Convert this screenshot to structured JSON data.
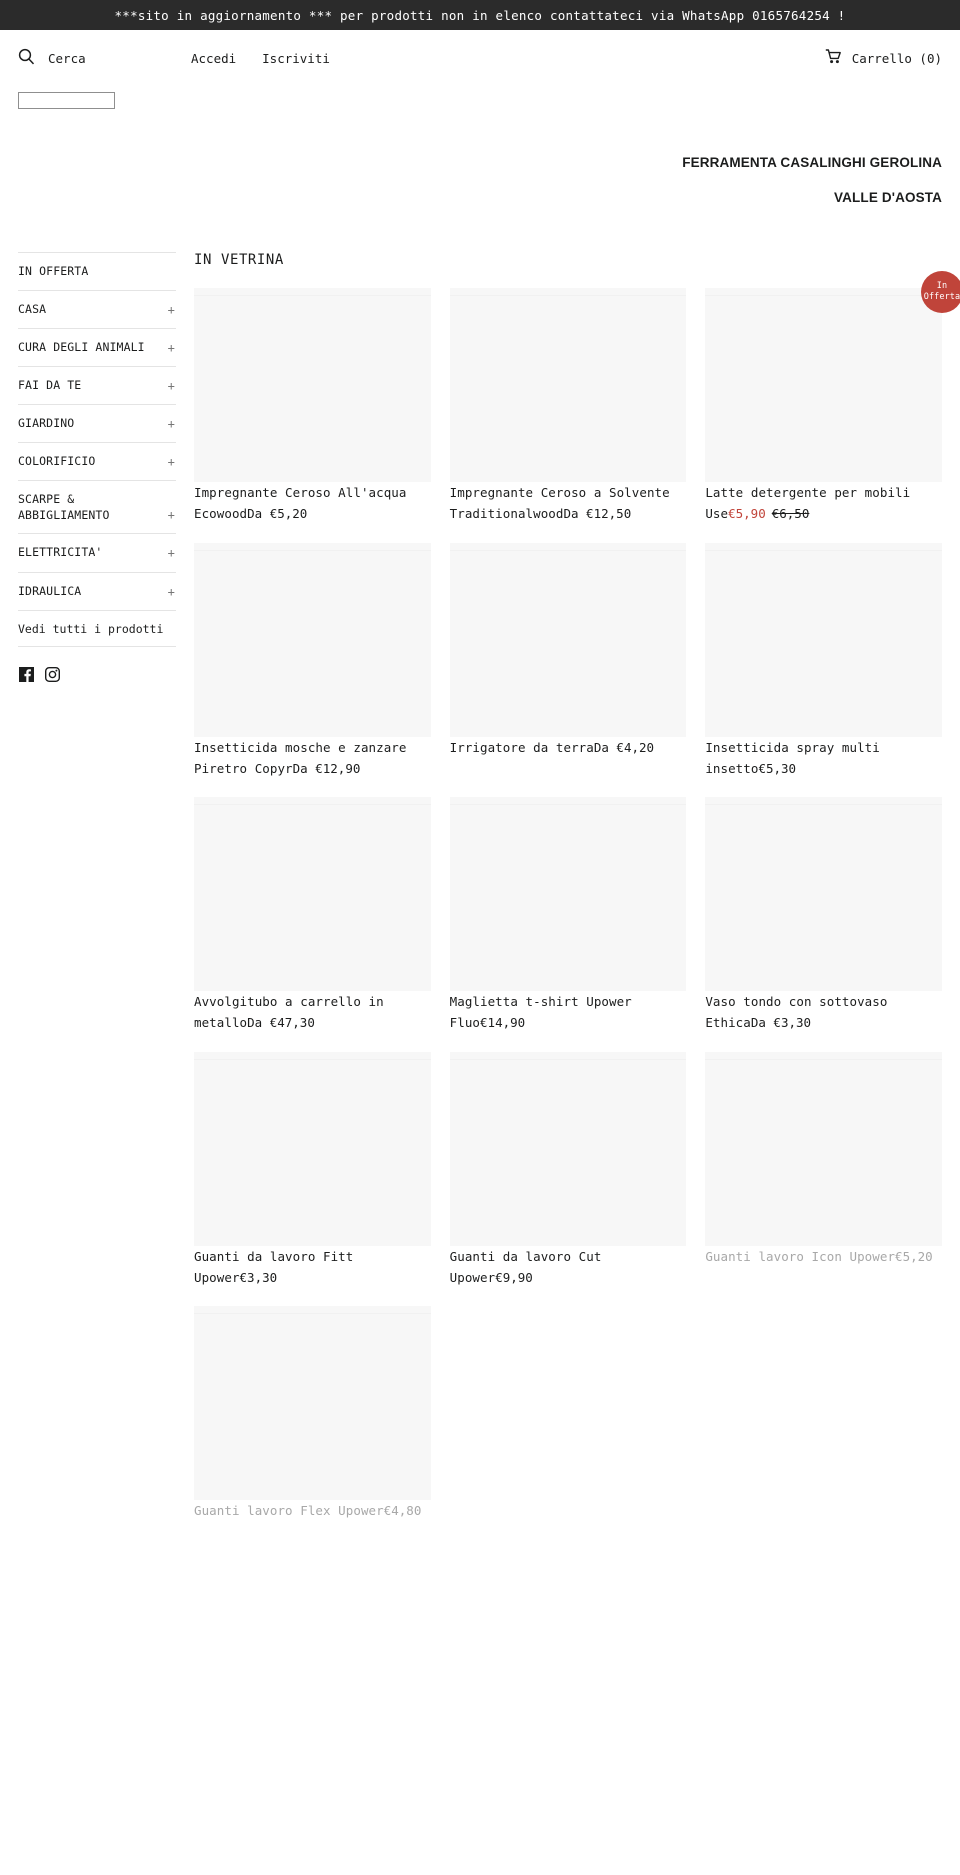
{
  "announcement": {
    "text": "***sito in aggiornamento *** per prodotti non in elenco contattateci via WhatsApp 0165764254 !"
  },
  "header": {
    "search_label": "Cerca",
    "search_placeholder": "",
    "search_value": "",
    "login_label": "Accedi",
    "register_label": "Iscriviti",
    "cart_label": "Carrello (0)"
  },
  "store": {
    "name_line1": "FERRAMENTA CASALINGHI GEROLINA",
    "name_line2": "VALLE D'AOSTA"
  },
  "sidebar": {
    "items": [
      {
        "label": "IN OFFERTA",
        "expander": ""
      },
      {
        "label": "CASA",
        "expander": "+"
      },
      {
        "label": "CURA DEGLI ANIMALI",
        "expander": "+"
      },
      {
        "label": "FAI DA TE",
        "expander": "+"
      },
      {
        "label": "GIARDINO",
        "expander": "+"
      },
      {
        "label": "COLORIFICIO",
        "expander": "+"
      },
      {
        "label": "SCARPE & ABBIGLIAMENTO",
        "expander": "+"
      },
      {
        "label": "ELETTRICITA'",
        "expander": "+"
      },
      {
        "label": "IDRAULICA",
        "expander": "+"
      }
    ],
    "view_all_label": "Vedi tutti i prodotti",
    "social": [
      {
        "name": "facebook-icon"
      },
      {
        "name": "instagram-icon"
      }
    ]
  },
  "main": {
    "section_title": "IN VETRINA",
    "products": [
      {
        "title": "Impregnante Ceroso All'acqua Ecowood",
        "price": "Da €5,20",
        "sale_price": "",
        "compare_price": "",
        "badge": "",
        "sold_out": false
      },
      {
        "title": "Impregnante Ceroso a Solvente Traditionalwood",
        "price": "Da €12,50",
        "sale_price": "",
        "compare_price": "",
        "badge": "",
        "sold_out": false
      },
      {
        "title": "Latte detergente per mobili Use",
        "price": "",
        "sale_price": "€5,90",
        "compare_price": "€6,50",
        "badge": "In Offerta",
        "sold_out": false
      },
      {
        "title": "Insetticida mosche e zanzare Piretro Copyr",
        "price": "Da €12,90",
        "sale_price": "",
        "compare_price": "",
        "badge": "",
        "sold_out": false
      },
      {
        "title": "Irrigatore da terra",
        "price": "Da €4,20",
        "sale_price": "",
        "compare_price": "",
        "badge": "",
        "sold_out": false
      },
      {
        "title": "Insetticida spray multi insetto",
        "price": "€5,30",
        "sale_price": "",
        "compare_price": "",
        "badge": "",
        "sold_out": false
      },
      {
        "title": "Avvolgitubo a carrello in metallo",
        "price": "Da €47,30",
        "sale_price": "",
        "compare_price": "",
        "badge": "",
        "sold_out": false
      },
      {
        "title": "Maglietta t-shirt Upower Fluo",
        "price": "€14,90",
        "sale_price": "",
        "compare_price": "",
        "badge": "",
        "sold_out": false
      },
      {
        "title": "Vaso tondo con sottovaso Ethica",
        "price": "Da €3,30",
        "sale_price": "",
        "compare_price": "",
        "badge": "",
        "sold_out": false
      },
      {
        "title": "Guanti da lavoro Fitt Upower",
        "price": "€3,30",
        "sale_price": "",
        "compare_price": "",
        "badge": "",
        "sold_out": false
      },
      {
        "title": "Guanti da lavoro Cut Upower",
        "price": "€9,90",
        "sale_price": "",
        "compare_price": "",
        "badge": "",
        "sold_out": false
      },
      {
        "title": "Guanti lavoro Icon Upower",
        "price": "€5,20",
        "sale_price": "",
        "compare_price": "",
        "badge": "",
        "sold_out": true
      },
      {
        "title": "Guanti lavoro Flex Upower",
        "price": "€4,80",
        "sale_price": "",
        "compare_price": "",
        "badge": "",
        "sold_out": true
      }
    ]
  },
  "colors": {
    "announcement_bg": "#2b2b2b",
    "text": "#1c1d1d",
    "sale_red": "#c0443a",
    "placeholder_bg": "#f7f7f7",
    "muted": "#a8a8a8",
    "rule": "#e4e4e4"
  }
}
